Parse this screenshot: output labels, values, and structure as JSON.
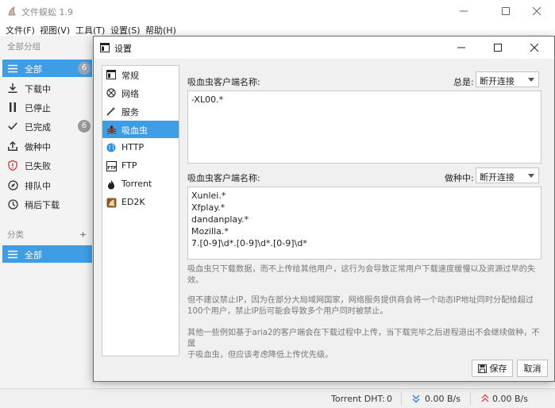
{
  "app": {
    "title": "文件蜈蚣 1.9"
  },
  "menu": [
    {
      "label": "文件(F)"
    },
    {
      "label": "视图(V)"
    },
    {
      "label": "工具(T)"
    },
    {
      "label": "设置(S)"
    },
    {
      "label": "帮助(H)"
    }
  ],
  "sidebar": {
    "group_all_label": "全部分组",
    "items": [
      {
        "label": "全部",
        "icon": "list-icon",
        "badge": "6",
        "selected": true
      },
      {
        "label": "下载中",
        "icon": "download-icon",
        "badge": ""
      },
      {
        "label": "已停止",
        "icon": "pause-icon",
        "badge": ""
      },
      {
        "label": "已完成",
        "icon": "check-icon",
        "badge": "6"
      },
      {
        "label": "做种中",
        "icon": "upload-icon",
        "badge": ""
      },
      {
        "label": "已失败",
        "icon": "error-shield-icon",
        "badge": ""
      },
      {
        "label": "排队中",
        "icon": "compass-icon",
        "badge": ""
      },
      {
        "label": "稍后下载",
        "icon": "clock-icon",
        "badge": ""
      }
    ],
    "category_header": "分类",
    "category_add": "+",
    "category_items": [
      {
        "label": "全部",
        "icon": "list-icon",
        "selected": true
      }
    ]
  },
  "statusbar": {
    "dht_label": "Torrent DHT:",
    "dht_value": "0",
    "download_speed": "0.00 B/s",
    "upload_speed": "0.00 B/s"
  },
  "dialog": {
    "title": "设置",
    "categories": [
      {
        "label": "常规",
        "icon": "general-icon"
      },
      {
        "label": "网络",
        "icon": "network-icon"
      },
      {
        "label": "服务",
        "icon": "service-wand-icon"
      },
      {
        "label": "吸血虫",
        "icon": "bug-icon",
        "selected": true
      },
      {
        "label": "HTTP",
        "icon": "globe-icon"
      },
      {
        "label": "FTP",
        "icon": "ftp-icon"
      },
      {
        "label": "Torrent",
        "icon": "torrent-icon"
      },
      {
        "label": "ED2K",
        "icon": "ed2k-icon"
      }
    ],
    "section1": {
      "label": "吸血虫客户端名称:",
      "action_label": "总是:",
      "action_value": "断开连接",
      "lines": [
        "-XL00.*"
      ]
    },
    "section2": {
      "label": "吸血虫客户端名称:",
      "action_label": "做种中:",
      "action_value": "断开连接",
      "lines": [
        "Xunlei.*",
        "Xfplay.*",
        "dandanplay.*",
        "Mozilla.*",
        "7.[0-9]\\d*.[0-9]\\d*.[0-9]\\d*"
      ]
    },
    "descriptions": [
      [
        "吸血虫只下载数据，而不上传给其他用户，这行为会导致正常用户下载速度缓慢以及资源过早的失",
        "效。"
      ],
      [
        "但不建议禁止IP，因为在部分大局域网国家，网络服务提供商会将一个动态IP地址同时分配给超过",
        "100个用户，禁止IP后可能会导致多个用户同时被禁止。"
      ],
      [
        "其他一些例如基于aria2的客户端会在下载过程中上传，当下载完毕之后进程退出不会继续做种，不属",
        "于吸血虫，但应该考虑降低上传优先级。"
      ]
    ],
    "save_label": "保存",
    "cancel_label": "取消"
  }
}
